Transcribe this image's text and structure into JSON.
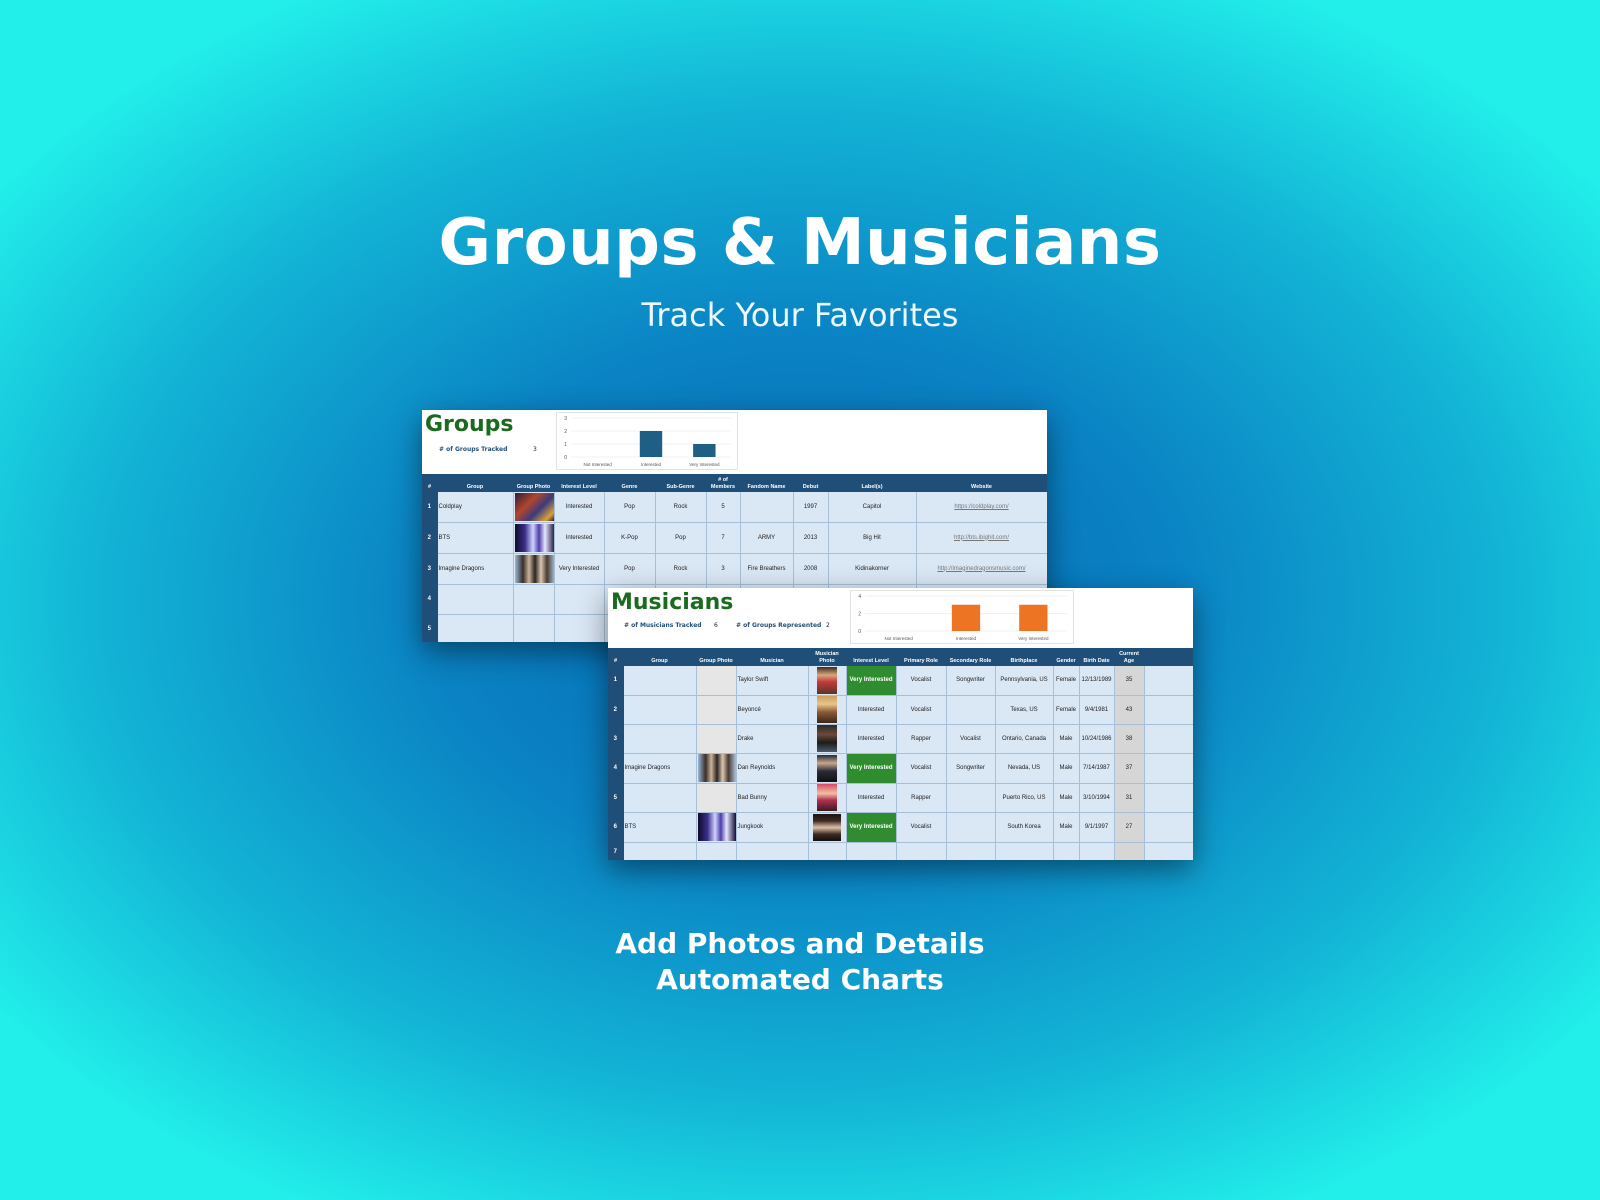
{
  "hero": {
    "title": "Groups & Musicians",
    "subtitle": "Track Your Favorites",
    "footer_line1": "Add Photos and Details",
    "footer_line2": "Automated Charts"
  },
  "groups": {
    "title": "Groups",
    "stat_label": "# of Groups Tracked",
    "stat_value": "3",
    "columns": [
      "#",
      "Group",
      "Group Photo",
      "Interest Level",
      "Genre",
      "Sub-Genre",
      "# of Members",
      "Fandom Name",
      "Debut",
      "Label(s)",
      "Website"
    ],
    "rows": [
      {
        "num": "1",
        "group": "Coldplay",
        "interest": "Interested",
        "genre": "Pop",
        "subgenre": "Rock",
        "members": "5",
        "fandom": "",
        "debut": "1997",
        "label": "Capitol",
        "website": "https://coldplay.com/"
      },
      {
        "num": "2",
        "group": "BTS",
        "interest": "Interested",
        "genre": "K-Pop",
        "subgenre": "Pop",
        "members": "7",
        "fandom": "ARMY",
        "debut": "2013",
        "label": "Big Hit",
        "website": "http://bts.ibighit.com/"
      },
      {
        "num": "3",
        "group": "Imagine Dragons",
        "interest": "Very Interested",
        "genre": "Pop",
        "subgenre": "Rock",
        "members": "3",
        "fandom": "Fire Breathers",
        "debut": "2008",
        "label": "Kidinakorner",
        "website": "http://imaginedragonsmusic.com/"
      },
      {
        "num": "4",
        "group": "",
        "interest": "",
        "genre": "",
        "subgenre": "",
        "members": "",
        "fandom": "",
        "debut": "",
        "label": "",
        "website": ""
      },
      {
        "num": "5",
        "group": "",
        "interest": "",
        "genre": "",
        "subgenre": "",
        "members": "",
        "fandom": "",
        "debut": "",
        "label": "",
        "website": ""
      }
    ]
  },
  "musicians": {
    "title": "Musicians",
    "stat1_label": "# of Musicians Tracked",
    "stat1_value": "6",
    "stat2_label": "# of Groups Represented",
    "stat2_value": "2",
    "columns": [
      "#",
      "Group",
      "Group Photo",
      "Musician",
      "Musician Photo",
      "Interest Level",
      "Primary Role",
      "Secondary Role",
      "Birthplace",
      "Gender",
      "Birth Date",
      "Current Age"
    ],
    "rows": [
      {
        "num": "1",
        "group": "",
        "musician": "Taylor Swift",
        "interest": "Very Interested",
        "primary": "Vocalist",
        "secondary": "Songwriter",
        "birthplace": "Pennsylvania, US",
        "gender": "Female",
        "birthdate": "12/13/1989",
        "age": "35"
      },
      {
        "num": "2",
        "group": "",
        "musician": "Beyoncé",
        "interest": "Interested",
        "primary": "Vocalist",
        "secondary": "",
        "birthplace": "Texas, US",
        "gender": "Female",
        "birthdate": "9/4/1981",
        "age": "43"
      },
      {
        "num": "3",
        "group": "",
        "musician": "Drake",
        "interest": "Interested",
        "primary": "Rapper",
        "secondary": "Vocalist",
        "birthplace": "Ontario, Canada",
        "gender": "Male",
        "birthdate": "10/24/1986",
        "age": "38"
      },
      {
        "num": "4",
        "group": "Imagine Dragons",
        "musician": "Dan Reynolds",
        "interest": "Very Interested",
        "primary": "Vocalist",
        "secondary": "Songwriter",
        "birthplace": "Nevada, US",
        "gender": "Male",
        "birthdate": "7/14/1987",
        "age": "37"
      },
      {
        "num": "5",
        "group": "",
        "musician": "Bad Bunny",
        "interest": "Interested",
        "primary": "Rapper",
        "secondary": "",
        "birthplace": "Puerto Rico, US",
        "gender": "Male",
        "birthdate": "3/10/1994",
        "age": "31"
      },
      {
        "num": "6",
        "group": "BTS",
        "musician": "Jungkook",
        "interest": "Very Interested",
        "primary": "Vocalist",
        "secondary": "",
        "birthplace": "South Korea",
        "gender": "Male",
        "birthdate": "9/1/1997",
        "age": "27"
      },
      {
        "num": "7",
        "group": "",
        "musician": "",
        "interest": "",
        "primary": "",
        "secondary": "",
        "birthplace": "",
        "gender": "",
        "birthdate": "",
        "age": ""
      }
    ]
  },
  "chart_data": [
    {
      "type": "bar",
      "categories": [
        "Not Interested",
        "Interested",
        "Very Interested"
      ],
      "values": [
        0,
        2,
        1
      ],
      "ylim": [
        0,
        3
      ],
      "yticks": [
        "0",
        "1",
        "2",
        "3"
      ],
      "color": "#1f5f86",
      "grid": true
    },
    {
      "type": "bar",
      "categories": [
        "Not Interested",
        "Interested",
        "Very Interested"
      ],
      "values": [
        0,
        3,
        3
      ],
      "ylim": [
        0,
        4
      ],
      "yticks": [
        "0",
        "2",
        "4"
      ],
      "color": "#ed7422",
      "grid": true
    }
  ]
}
